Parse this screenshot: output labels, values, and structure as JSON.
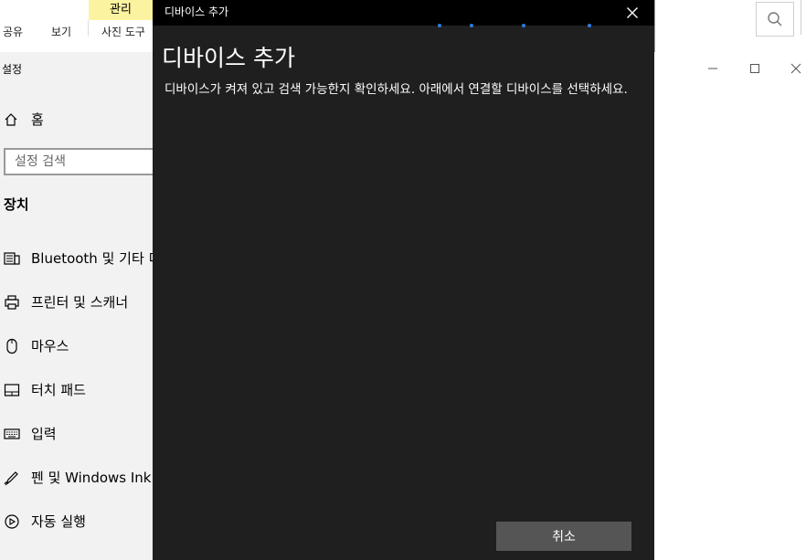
{
  "explorer": {
    "manage_tab": "관리",
    "tabs": [
      "공유",
      "보기",
      "사진 도구"
    ]
  },
  "settings": {
    "window_title": "설정",
    "home_label": "홈",
    "search_placeholder": "설정 검색",
    "section_title": "장치",
    "nav_items": [
      {
        "label": "Bluetooth 및 기타 디",
        "icon": "keyboard-devices-icon"
      },
      {
        "label": "프린터 및 스캐너",
        "icon": "printer-icon"
      },
      {
        "label": "마우스",
        "icon": "mouse-icon"
      },
      {
        "label": "터치 패드",
        "icon": "touchpad-icon"
      },
      {
        "label": "입력",
        "icon": "keyboard-icon"
      },
      {
        "label": "펜 및 Windows Ink",
        "icon": "pen-icon"
      },
      {
        "label": "자동 실행",
        "icon": "autoplay-icon"
      }
    ]
  },
  "dialog": {
    "title_bar": "디바이스 추가",
    "heading": "디바이스 추가",
    "description": "디바이스가 켜져 있고 검색 가능한지 확인하세요. 아래에서 연결할 디바이스를 선택하세요.",
    "cancel_label": "취소"
  },
  "colors": {
    "dialog_bg": "#1f1f1f",
    "titlebar_bg": "#000000",
    "progress_dot": "#2a7de1",
    "manage_tab_bg": "#fcf3a0",
    "cancel_bg": "#555555"
  }
}
